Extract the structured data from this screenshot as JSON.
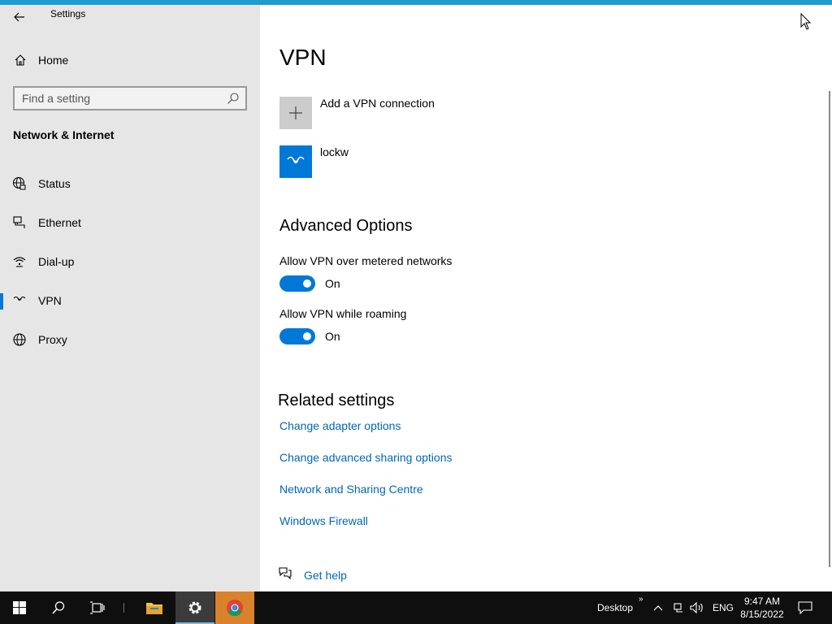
{
  "window": {
    "title": "Settings"
  },
  "sidebar": {
    "home_label": "Home",
    "search_placeholder": "Find a setting",
    "section_heading": "Network & Internet",
    "items": [
      {
        "label": "Status",
        "icon": "globe-status-icon"
      },
      {
        "label": "Ethernet",
        "icon": "ethernet-icon"
      },
      {
        "label": "Dial-up",
        "icon": "dial-up-icon"
      },
      {
        "label": "VPN",
        "icon": "vpn-icon",
        "selected": true
      },
      {
        "label": "Proxy",
        "icon": "globe-icon"
      }
    ]
  },
  "main": {
    "title": "VPN",
    "add_vpn_label": "Add a VPN connection",
    "connection_name": "lockw",
    "advanced_heading": "Advanced Options",
    "options": [
      {
        "label": "Allow VPN over metered networks",
        "state": "On"
      },
      {
        "label": "Allow VPN while roaming",
        "state": "On"
      }
    ],
    "related_heading": "Related settings",
    "related_links": [
      "Change adapter options",
      "Change advanced sharing options",
      "Network and Sharing Centre",
      "Windows Firewall"
    ],
    "help_label": "Get help"
  },
  "taskbar": {
    "desktop_label": "Desktop",
    "language": "ENG",
    "time": "9:47 AM",
    "date": "8/15/2022"
  },
  "colors": {
    "accent": "#0078d7",
    "link": "#0067b8",
    "sidebar_bg": "#e6e6e6",
    "close_hover": "#e81123",
    "top_accent": "#1e9ccf"
  }
}
